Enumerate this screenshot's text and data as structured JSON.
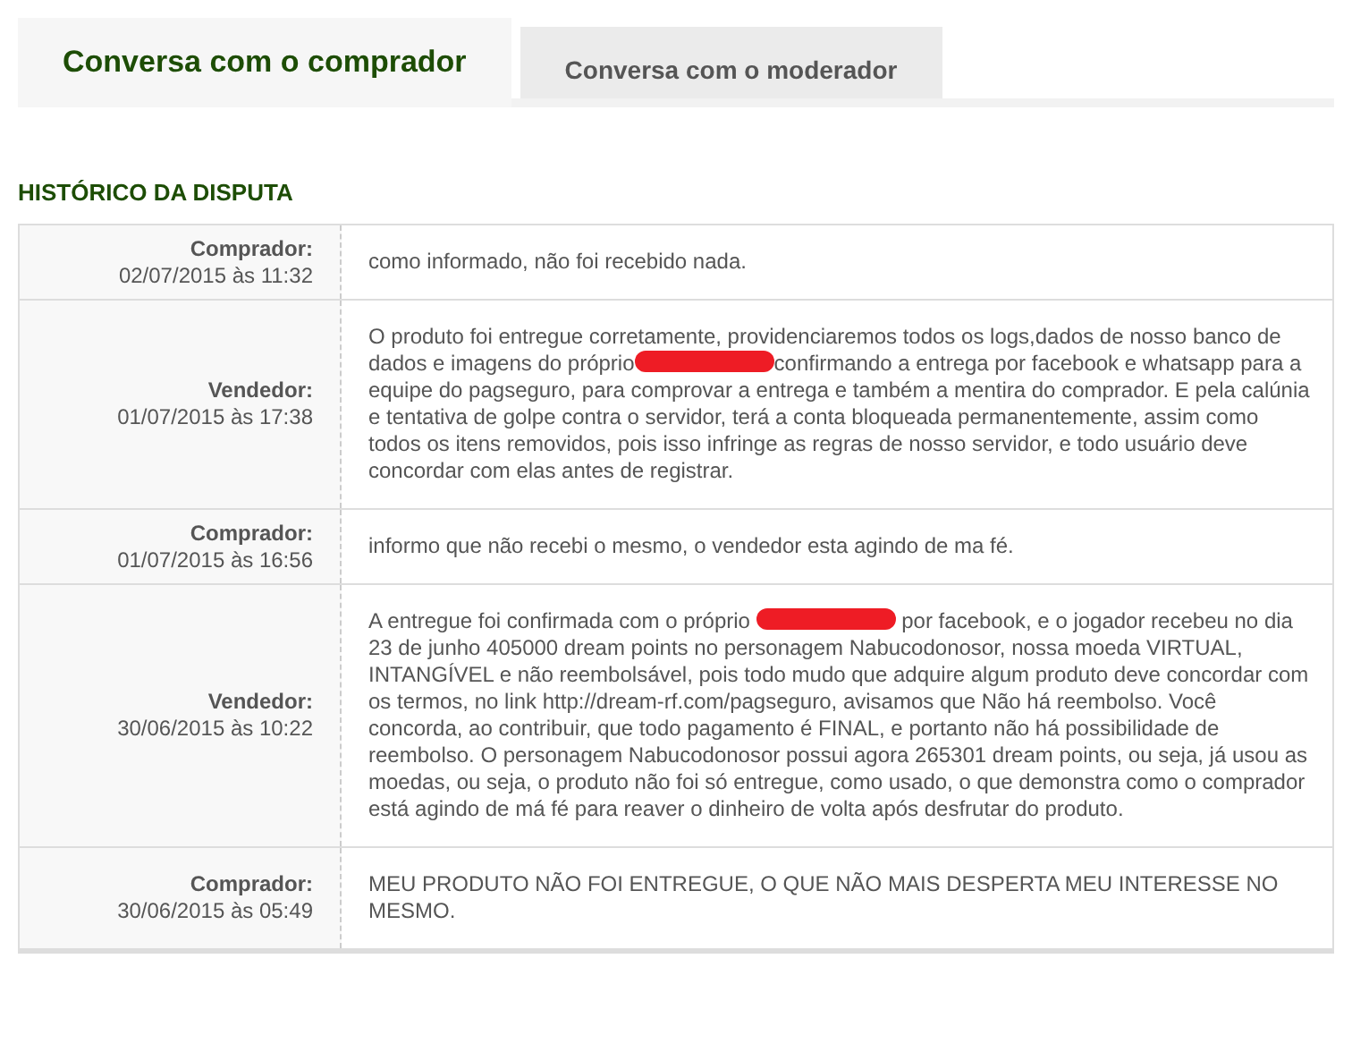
{
  "tabs": [
    {
      "label": "Conversa com o comprador",
      "selected": true
    },
    {
      "label": "Conversa com o moderador",
      "selected": false
    }
  ],
  "section_title": "HISTÓRICO DA DISPUTA",
  "messages": [
    {
      "author": "Comprador:",
      "datetime": "02/07/2015 às 11:32",
      "segments": [
        {
          "kind": "text",
          "text": "como informado, não foi recebido nada."
        }
      ]
    },
    {
      "author": "Vendedor:",
      "datetime": "01/07/2015 às 17:38",
      "segments": [
        {
          "kind": "text",
          "text": "O produto foi entregue corretamente, providenciaremos todos os logs,dados de nosso banco de dados e imagens do próprio"
        },
        {
          "kind": "redaction"
        },
        {
          "kind": "text",
          "text": "confirmando a entrega por facebook e whatsapp para a equipe do pagseguro, para comprovar a entrega e também a mentira do comprador. E pela calúnia e tentativa de golpe contra o servidor, terá a conta bloqueada permanentemente, assim como todos os itens removidos, pois isso infringe as regras de nosso servidor, e todo usuário deve concordar com elas antes de registrar."
        }
      ]
    },
    {
      "author": "Comprador:",
      "datetime": "01/07/2015 às 16:56",
      "segments": [
        {
          "kind": "text",
          "text": "informo que não recebi o mesmo, o vendedor esta agindo de ma fé."
        }
      ]
    },
    {
      "author": "Vendedor:",
      "datetime": "30/06/2015 às 10:22",
      "segments": [
        {
          "kind": "text",
          "text": "A entregue foi confirmada com o próprio "
        },
        {
          "kind": "redaction"
        },
        {
          "kind": "text",
          "text": " por facebook, e o jogador recebeu no dia 23 de junho 405000 dream points no personagem Nabucodonosor, nossa moeda VIRTUAL, INTANGÍVEL e não reembolsável, pois todo mudo que adquire algum produto deve concordar com os termos, no link http://dream-rf.com/pagseguro, avisamos que Não há reembolso. Você concorda, ao contribuir, que todo pagamento é FINAL, e portanto não há possibilidade de reembolso. O personagem Nabucodonosor possui agora 265301 dream points, ou seja, já usou as moedas, ou seja, o produto não foi só entregue, como usado, o que demonstra como o comprador está agindo de má fé para reaver o dinheiro de volta após desfrutar do produto."
        }
      ]
    },
    {
      "author": "Comprador:",
      "datetime": "30/06/2015 às 05:49",
      "segments": [
        {
          "kind": "text",
          "text": "MEU PRODUTO NÃO FOI ENTREGUE, O QUE NÃO MAIS DESPERTA MEU INTERESSE NO MESMO."
        }
      ]
    }
  ]
}
